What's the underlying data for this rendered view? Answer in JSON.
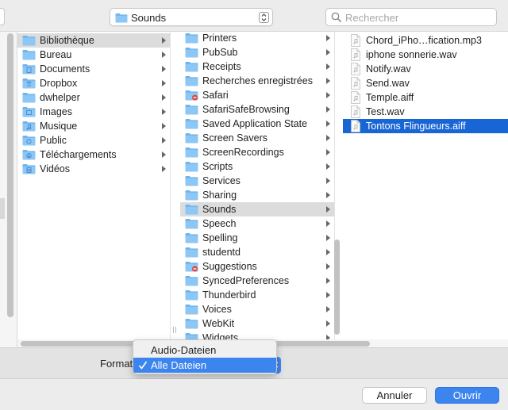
{
  "toolbar": {
    "location": "Sounds",
    "search_placeholder": "Rechercher"
  },
  "column1": [
    {
      "label": "Bibliothèque",
      "icon": "folder-icon",
      "chevron": true,
      "selected": "gray"
    },
    {
      "label": "Bureau",
      "icon": "folder-icon",
      "chevron": true
    },
    {
      "label": "Documents",
      "icon": "documents-folder-icon",
      "chevron": true
    },
    {
      "label": "Dropbox",
      "icon": "dropbox-folder-icon",
      "chevron": true
    },
    {
      "label": "dwhelper",
      "icon": "folder-icon",
      "chevron": true
    },
    {
      "label": "Images",
      "icon": "pictures-folder-icon",
      "chevron": true
    },
    {
      "label": "Musique",
      "icon": "music-folder-icon",
      "chevron": true
    },
    {
      "label": "Public",
      "icon": "public-folder-icon",
      "chevron": true
    },
    {
      "label": "Téléchargements",
      "icon": "downloads-folder-icon",
      "chevron": true
    },
    {
      "label": "Vidéos",
      "icon": "movies-folder-icon",
      "chevron": true
    }
  ],
  "column2": [
    {
      "label": "Printers",
      "icon": "folder-icon",
      "chevron": true
    },
    {
      "label": "PubSub",
      "icon": "folder-icon",
      "chevron": true
    },
    {
      "label": "Receipts",
      "icon": "folder-icon",
      "chevron": true
    },
    {
      "label": "Recherches enregistrées",
      "icon": "folder-icon",
      "chevron": true
    },
    {
      "label": "Safari",
      "icon": "restricted-folder-icon",
      "chevron": true
    },
    {
      "label": "SafariSafeBrowsing",
      "icon": "folder-icon",
      "chevron": true
    },
    {
      "label": "Saved Application State",
      "icon": "folder-icon",
      "chevron": true
    },
    {
      "label": "Screen Savers",
      "icon": "folder-icon",
      "chevron": true
    },
    {
      "label": "ScreenRecordings",
      "icon": "folder-icon",
      "chevron": true
    },
    {
      "label": "Scripts",
      "icon": "folder-icon",
      "chevron": true
    },
    {
      "label": "Services",
      "icon": "folder-icon",
      "chevron": true
    },
    {
      "label": "Sharing",
      "icon": "folder-icon",
      "chevron": true
    },
    {
      "label": "Sounds",
      "icon": "folder-icon",
      "chevron": true,
      "selected": "gray"
    },
    {
      "label": "Speech",
      "icon": "folder-icon",
      "chevron": true
    },
    {
      "label": "Spelling",
      "icon": "folder-icon",
      "chevron": true
    },
    {
      "label": "studentd",
      "icon": "folder-icon",
      "chevron": true
    },
    {
      "label": "Suggestions",
      "icon": "restricted-folder-icon",
      "chevron": true
    },
    {
      "label": "SyncedPreferences",
      "icon": "folder-icon",
      "chevron": true
    },
    {
      "label": "Thunderbird",
      "icon": "folder-icon",
      "chevron": true
    },
    {
      "label": "Voices",
      "icon": "folder-icon",
      "chevron": true
    },
    {
      "label": "WebKit",
      "icon": "folder-icon",
      "chevron": true
    },
    {
      "label": "Widgets",
      "icon": "folder-icon",
      "chevron": true
    }
  ],
  "column3": [
    {
      "label": "Chord_iPho…fication.mp3",
      "icon": "audio-file-icon"
    },
    {
      "label": "iphone sonnerie.wav",
      "icon": "audio-file-icon"
    },
    {
      "label": "Notify.wav",
      "icon": "audio-file-icon"
    },
    {
      "label": "Send.wav",
      "icon": "audio-file-icon"
    },
    {
      "label": "Temple.aiff",
      "icon": "audio-file-icon"
    },
    {
      "label": "Test.wav",
      "icon": "audio-file-icon"
    },
    {
      "label": "Tontons Flingueurs.aiff",
      "icon": "audio-file-icon",
      "selected": "blue"
    }
  ],
  "format": {
    "label": "Format",
    "options": [
      "Audio-Dateien",
      "Alle Dateien"
    ],
    "selected": "Alle Dateien"
  },
  "buttons": {
    "cancel": "Annuler",
    "open": "Ouvrir"
  },
  "colors": {
    "accent": "#3c85ef",
    "selection_blue": "#1866d6",
    "selection_gray": "#dcdcdc",
    "folder_blue": "#6cb4ee"
  }
}
